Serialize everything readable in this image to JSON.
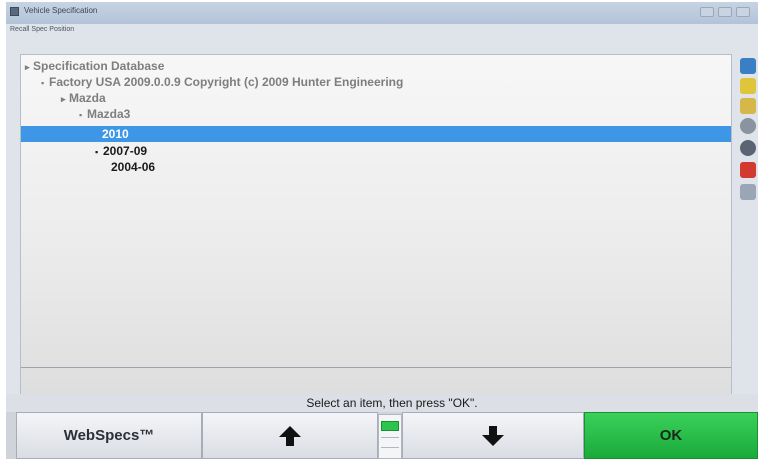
{
  "window": {
    "title": "Vehicle Specification",
    "subtitle": "Recall Spec Position"
  },
  "tree": {
    "items": [
      {
        "label": "Specification Database",
        "bullet": "▸"
      },
      {
        "label": "Factory USA 2009.0.0.9 Copyright (c) 2009 Hunter Engineering",
        "bullet": "▪"
      },
      {
        "label": "Mazda",
        "bullet": "▸"
      },
      {
        "label": "Mazda3",
        "bullet": "▪"
      },
      {
        "label": "2010",
        "bullet": "",
        "selected": true
      },
      {
        "label": "2007-09",
        "bullet": "▪"
      },
      {
        "label": "2004-06",
        "bullet": ""
      }
    ]
  },
  "status": {
    "text": "Select an item, then press \"OK\"."
  },
  "buttons": {
    "webspecs": "WebSpecs™",
    "ok": "OK"
  },
  "colors": {
    "selection": "#3d97e6",
    "ok_button": "#22b844"
  },
  "toolbar_icons": [
    "car-info-icon",
    "ruler-icon",
    "wrench-icon",
    "target-icon",
    "tire-icon",
    "flag-icon",
    "printer-icon"
  ]
}
